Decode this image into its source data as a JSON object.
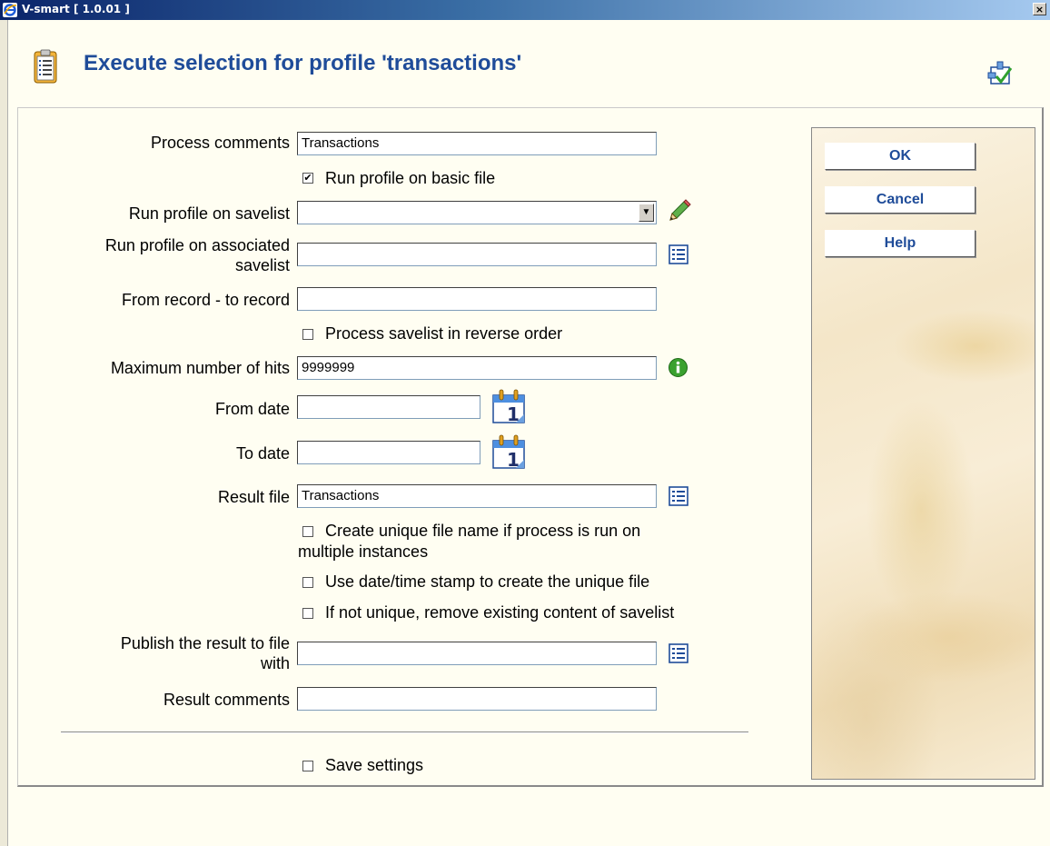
{
  "window": {
    "title": "V-smart [ 1.0.01 ]",
    "close_label": "×"
  },
  "page": {
    "title": "Execute selection for profile 'transactions'"
  },
  "form": {
    "process_comments": {
      "label": "Process comments",
      "value": "Transactions"
    },
    "run_on_basic_file": {
      "label": "Run profile on basic file",
      "checked": true,
      "mark": "✔"
    },
    "run_on_savelist": {
      "label": "Run profile on savelist",
      "value": ""
    },
    "run_on_associated_savelist": {
      "label_line1": "Run profile on associated",
      "label_line2": "savelist",
      "value": ""
    },
    "record_range": {
      "label": "From record - to record",
      "value": ""
    },
    "reverse_order": {
      "label": "Process savelist in reverse order",
      "checked": false
    },
    "max_hits": {
      "label": "Maximum number of hits",
      "value": "9999999"
    },
    "from_date": {
      "label": "From date",
      "value": ""
    },
    "to_date": {
      "label": "To date",
      "value": ""
    },
    "result_file": {
      "label": "Result file",
      "value": "Transactions"
    },
    "unique_file_name": {
      "label_line1": "Create unique file name if process is run on",
      "label_line2": "multiple instances",
      "checked": false
    },
    "date_time_stamp": {
      "label": "Use date/time stamp to create the unique file",
      "checked": false
    },
    "remove_existing": {
      "label": "If not unique, remove existing content of savelist",
      "checked": false
    },
    "publish_result": {
      "label_line1": "Publish the result to file",
      "label_line2": "with",
      "value": ""
    },
    "result_comments": {
      "label": "Result comments",
      "value": ""
    },
    "save_settings": {
      "label": "Save settings",
      "checked": false
    }
  },
  "buttons": {
    "ok": "OK",
    "cancel": "Cancel",
    "help": "Help"
  },
  "calendar": {
    "day": "1"
  },
  "colors": {
    "title": "#1f4c99",
    "button_text": "#1f4c99"
  }
}
